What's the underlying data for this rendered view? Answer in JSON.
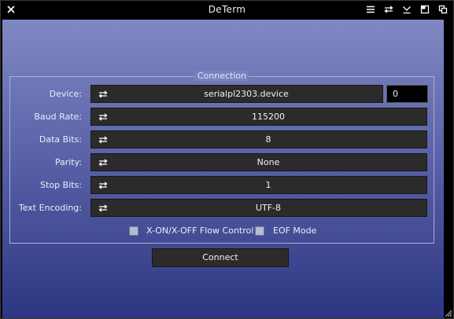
{
  "window": {
    "title": "DeTerm"
  },
  "connection": {
    "group_title": "Connection",
    "device": {
      "label": "Device:",
      "value": "serialpl2303.device",
      "unit": "0"
    },
    "baud_rate": {
      "label": "Baud Rate:",
      "value": "115200"
    },
    "data_bits": {
      "label": "Data Bits:",
      "value": "8"
    },
    "parity": {
      "label": "Parity:",
      "value": "None"
    },
    "stop_bits": {
      "label": "Stop Bits:",
      "value": "1"
    },
    "text_encoding": {
      "label": "Text Encoding:",
      "value": "UTF-8"
    },
    "xon_xoff": {
      "label": "X-ON/X-OFF Flow Control",
      "checked": false
    },
    "eof_mode": {
      "label": "EOF Mode",
      "checked": false
    }
  },
  "actions": {
    "connect_label": "Connect"
  },
  "colors": {
    "title_bar": "#000000",
    "gradient_top": "#8088c3",
    "gradient_bottom": "#2d3682",
    "control_bg": "#2b2b2b"
  },
  "icons": {
    "close": "close-icon",
    "menu": "menu-icon",
    "swap": "swap-icon",
    "minimize": "minimize-icon",
    "maximize": "maximize-icon",
    "restore": "restore-icon"
  }
}
